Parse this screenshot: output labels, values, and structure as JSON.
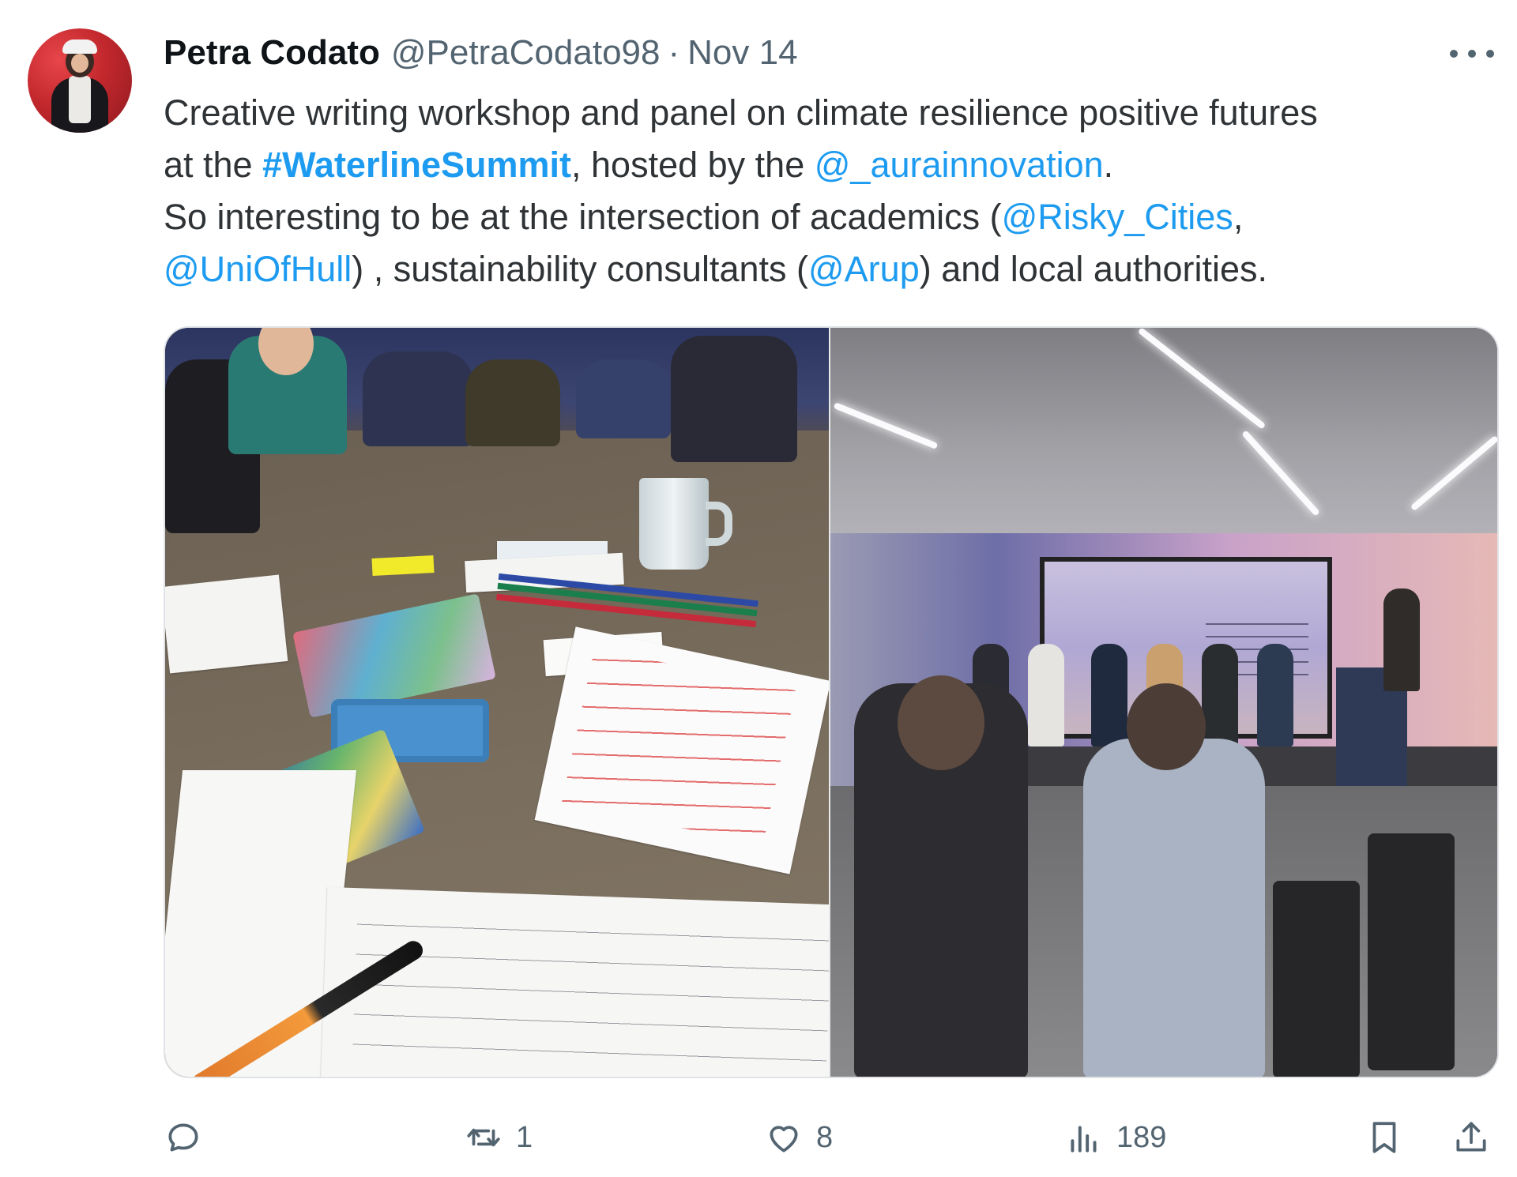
{
  "author": {
    "name": "Petra Codato",
    "handle": "@PetraCodato98",
    "separator": "·",
    "date": "Nov 14"
  },
  "text": {
    "line1": "Creative writing workshop and panel on climate resilience positive futures",
    "line2_pre": "at the ",
    "hashtag": "#WaterlineSummit",
    "line2_mid": ", hosted by the ",
    "mention_host": "@_aurainnovation",
    "line2_end": ".",
    "line3_pre": "So interesting to be at the intersection of academics (",
    "mention_risky": "@Risky_Cities",
    "line3_end": ",",
    "mention_hull": "@UniOfHull",
    "line4_mid": ") , sustainability consultants (",
    "mention_arup": "@Arup",
    "line4_end": ") and local authorities."
  },
  "actions": {
    "reply_count": "",
    "retweet_count": "1",
    "like_count": "8",
    "views_count": "189"
  },
  "icons": {
    "more": "more-dots-icon",
    "reply": "reply-icon",
    "retweet": "retweet-icon",
    "like": "heart-icon",
    "views": "views-icon",
    "bookmark": "bookmark-icon",
    "share": "share-icon"
  },
  "colors": {
    "text": "#0f1419",
    "body_text": "#2f3336",
    "muted": "#536471",
    "link": "#1d9bf0"
  }
}
